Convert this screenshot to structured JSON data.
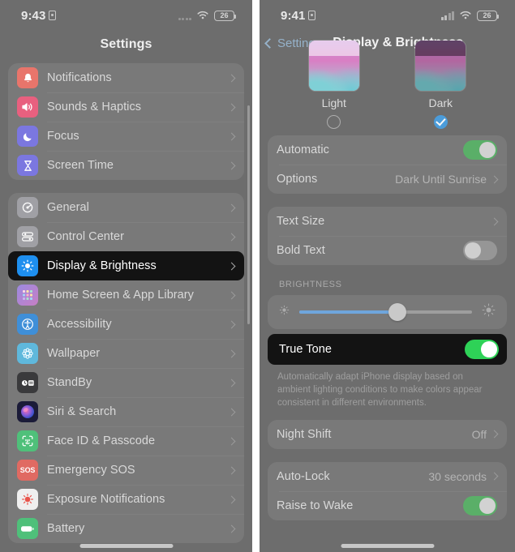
{
  "left": {
    "status": {
      "time": "9:43",
      "lock_icon": "lock-portrait-icon",
      "dots_icon": "cellular-dots-icon",
      "wifi_icon": "wifi-icon",
      "battery_level": "26"
    },
    "title": "Settings",
    "groups": [
      {
        "items": [
          {
            "label": "Notifications",
            "icon": "notifications-bell-icon",
            "color": "#e8756b"
          },
          {
            "label": "Sounds & Haptics",
            "icon": "speaker-waves-icon",
            "color": "#e8607f"
          },
          {
            "label": "Focus",
            "icon": "moon-crescent-icon",
            "color": "#7b77e0"
          },
          {
            "label": "Screen Time",
            "icon": "hourglass-icon",
            "color": "#7b77e0"
          }
        ]
      },
      {
        "items": [
          {
            "label": "General",
            "icon": "gear-icon",
            "color": "#a0a0a5"
          },
          {
            "label": "Control Center",
            "icon": "sliders-icon",
            "color": "#a0a0a5"
          },
          {
            "label": "Display & Brightness",
            "icon": "brightness-sun-icon",
            "color": "#1e8fef",
            "selected": true
          },
          {
            "label": "Home Screen & App Library",
            "icon": "app-grid-icon",
            "color": "#8a7fd8"
          },
          {
            "label": "Accessibility",
            "icon": "accessibility-person-icon",
            "color": "#3f8fd8"
          },
          {
            "label": "Wallpaper",
            "icon": "wallpaper-flower-icon",
            "color": "#5fb8dc"
          },
          {
            "label": "StandBy",
            "icon": "standby-clock-icon",
            "color": "#3a3a3c"
          },
          {
            "label": "Siri & Search",
            "icon": "siri-orb-icon",
            "color": "#2b2b4f"
          },
          {
            "label": "Face ID & Passcode",
            "icon": "face-id-icon",
            "color": "#4fc07a"
          },
          {
            "label": "Emergency SOS",
            "icon": "sos-icon",
            "color": "#e06a62"
          },
          {
            "label": "Exposure Notifications",
            "icon": "exposure-virus-icon",
            "color": "#efefef"
          },
          {
            "label": "Battery",
            "icon": "battery-icon",
            "color": "#4fc07a"
          }
        ]
      }
    ]
  },
  "right": {
    "status": {
      "time": "9:41",
      "lock_icon": "lock-portrait-icon",
      "signal_icon": "cellular-signal-icon",
      "wifi_icon": "wifi-icon",
      "battery_level": "26"
    },
    "back_label": "Settings",
    "title": "Display & Brightness",
    "appearance": {
      "options": [
        {
          "label": "Light",
          "selected": false
        },
        {
          "label": "Dark",
          "selected": true
        }
      ]
    },
    "group_appearance": [
      {
        "label": "Automatic",
        "type": "toggle",
        "on": true
      },
      {
        "label": "Options",
        "type": "value",
        "value": "Dark Until Sunrise"
      }
    ],
    "group_text": [
      {
        "label": "Text Size",
        "type": "chevron"
      },
      {
        "label": "Bold Text",
        "type": "toggle",
        "on": false
      }
    ],
    "brightness": {
      "section_label": "BRIGHTNESS",
      "slider_percent": 57,
      "low_icon": "sun-small-icon",
      "high_icon": "sun-large-icon"
    },
    "true_tone": {
      "label": "True Tone",
      "on": true,
      "highlighted": true,
      "footnote": "Automatically adapt iPhone display based on ambient lighting conditions to make colors appear consistent in different environments."
    },
    "group_night": [
      {
        "label": "Night Shift",
        "type": "value",
        "value": "Off"
      }
    ],
    "group_lock": [
      {
        "label": "Auto-Lock",
        "type": "value",
        "value": "30 seconds"
      },
      {
        "label": "Raise to Wake",
        "type": "toggle",
        "on": true
      }
    ]
  }
}
